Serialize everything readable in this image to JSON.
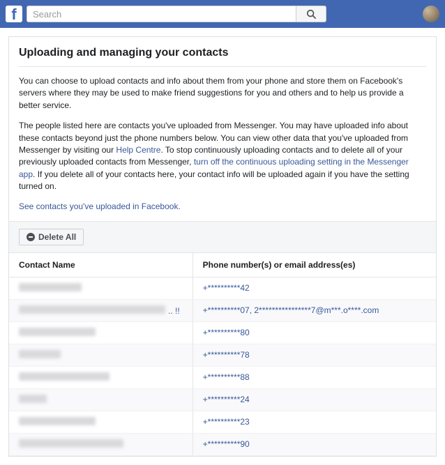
{
  "search": {
    "placeholder": "Search"
  },
  "page": {
    "title": "Uploading and managing your contacts",
    "para1": "You can choose to upload contacts and info about them from your phone and store them on Facebook's servers where they may be used to make friend suggestions for you and others and to help us provide a better service.",
    "para2a": "The people listed here are contacts you've uploaded from Messenger. You may have uploaded info about these contacts beyond just the phone numbers below. You can view other data that you've uploaded from Messenger by visiting our ",
    "help_centre": "Help Centre",
    "para2b": ". To stop continuously uploading contacts and to delete all of your previously uploaded contacts from Messenger, ",
    "turnoff_link": "turn off the continuous uploading setting in the Messenger app",
    "para2c": ". If you delete all of your contacts here, your contact info will be uploaded again if you have the setting turned on.",
    "see_contacts": "See contacts you've uploaded in Facebook."
  },
  "actions": {
    "delete_all": "Delete All"
  },
  "table": {
    "col_name": "Contact Name",
    "col_phone": "Phone number(s) or email address(es)",
    "rows": [
      {
        "name_suffix": "",
        "phone": "+**********42"
      },
      {
        "name_suffix": ".. !!",
        "phone": "+**********07, 2****************7@m***.o****.com"
      },
      {
        "name_suffix": "",
        "phone": "+**********80"
      },
      {
        "name_suffix": "",
        "phone": "+**********78"
      },
      {
        "name_suffix": "",
        "phone": "+**********88"
      },
      {
        "name_suffix": "",
        "phone": "+**********24"
      },
      {
        "name_suffix": "",
        "phone": "+**********23"
      },
      {
        "name_suffix": "",
        "phone": "+**********90"
      }
    ],
    "blur_widths": [
      90,
      210,
      110,
      60,
      130,
      40,
      110,
      150
    ]
  }
}
